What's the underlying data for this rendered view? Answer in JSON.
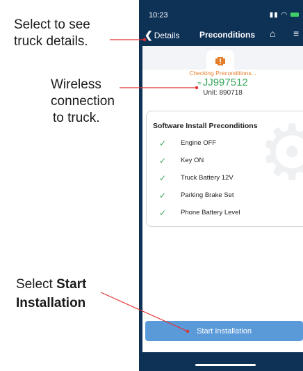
{
  "callouts": {
    "details_line1": "Select to see",
    "details_line2": "truck details.",
    "wireless_line1": "Wireless",
    "wireless_line2": "connection",
    "wireless_line3": "to truck.",
    "start_prefix": "Select ",
    "start_bold1": "Start",
    "start_bold2": "Installation"
  },
  "status_bar": {
    "time": "10:23",
    "icons": "signal wifi battery"
  },
  "nav": {
    "back_label": "Details",
    "title": "Preconditions",
    "home_icon": "home-icon",
    "menu_icon": "menu-icon"
  },
  "connection": {
    "status": "Checking Preconditions...",
    "truck_id": "JJ997512",
    "unit": "Unit: 890718"
  },
  "preconditions": {
    "title": "Software Install Preconditions",
    "items": [
      {
        "label": "Engine OFF"
      },
      {
        "label": "Key ON"
      },
      {
        "label": "Truck Battery 12V"
      },
      {
        "label": "Parking Brake Set"
      },
      {
        "label": "Phone Battery Level"
      }
    ]
  },
  "actions": {
    "start_label": "Start Installation"
  },
  "colors": {
    "nav_background": "#0e3156",
    "status_orange": "#e57e2a",
    "connected_green": "#3aa65b",
    "button_blue": "#5b9ad9",
    "callout_line": "#e03030"
  }
}
